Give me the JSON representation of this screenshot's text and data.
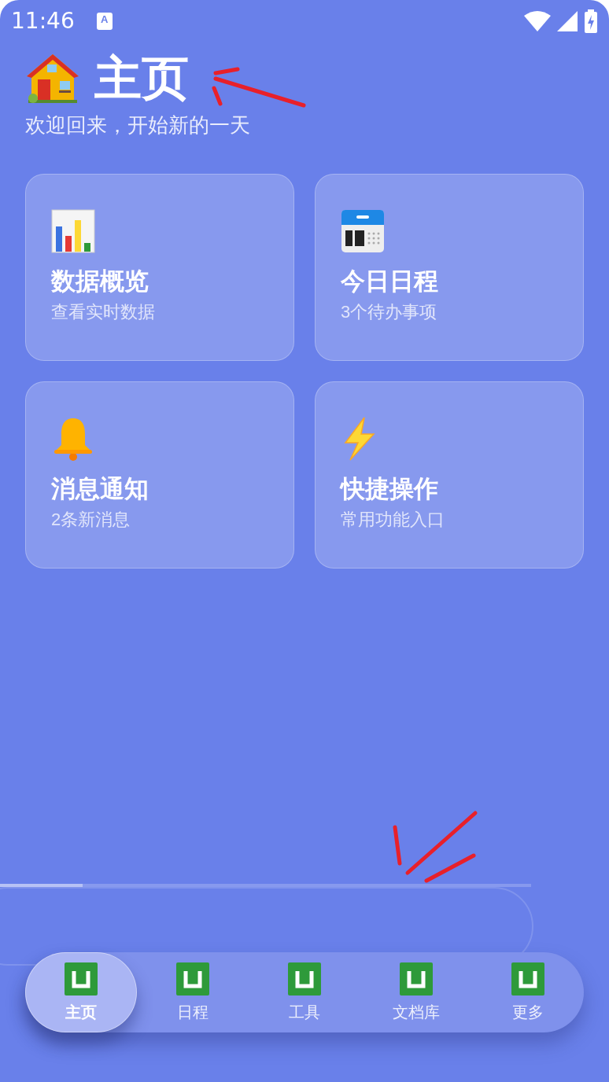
{
  "status_bar": {
    "time": "11:46",
    "notification_letter": "A"
  },
  "header": {
    "title": "主页",
    "subtitle": "欢迎回来，开始新的一天"
  },
  "cards": [
    {
      "kind": "chart",
      "title": "数据概览",
      "subtitle": "查看实时数据"
    },
    {
      "kind": "calendar",
      "title": "今日日程",
      "subtitle": "3个待办事项"
    },
    {
      "kind": "bell",
      "title": "消息通知",
      "subtitle": "2条新消息"
    },
    {
      "kind": "bolt",
      "title": "快捷操作",
      "subtitle": "常用功能入口"
    }
  ],
  "progress": {
    "level": 0.155
  },
  "tabs": [
    {
      "label": "主页",
      "selected": true
    },
    {
      "label": "日程",
      "selected": false
    },
    {
      "label": "工具",
      "selected": false
    },
    {
      "label": "文档库",
      "selected": false
    },
    {
      "label": "更多",
      "selected": false
    }
  ]
}
